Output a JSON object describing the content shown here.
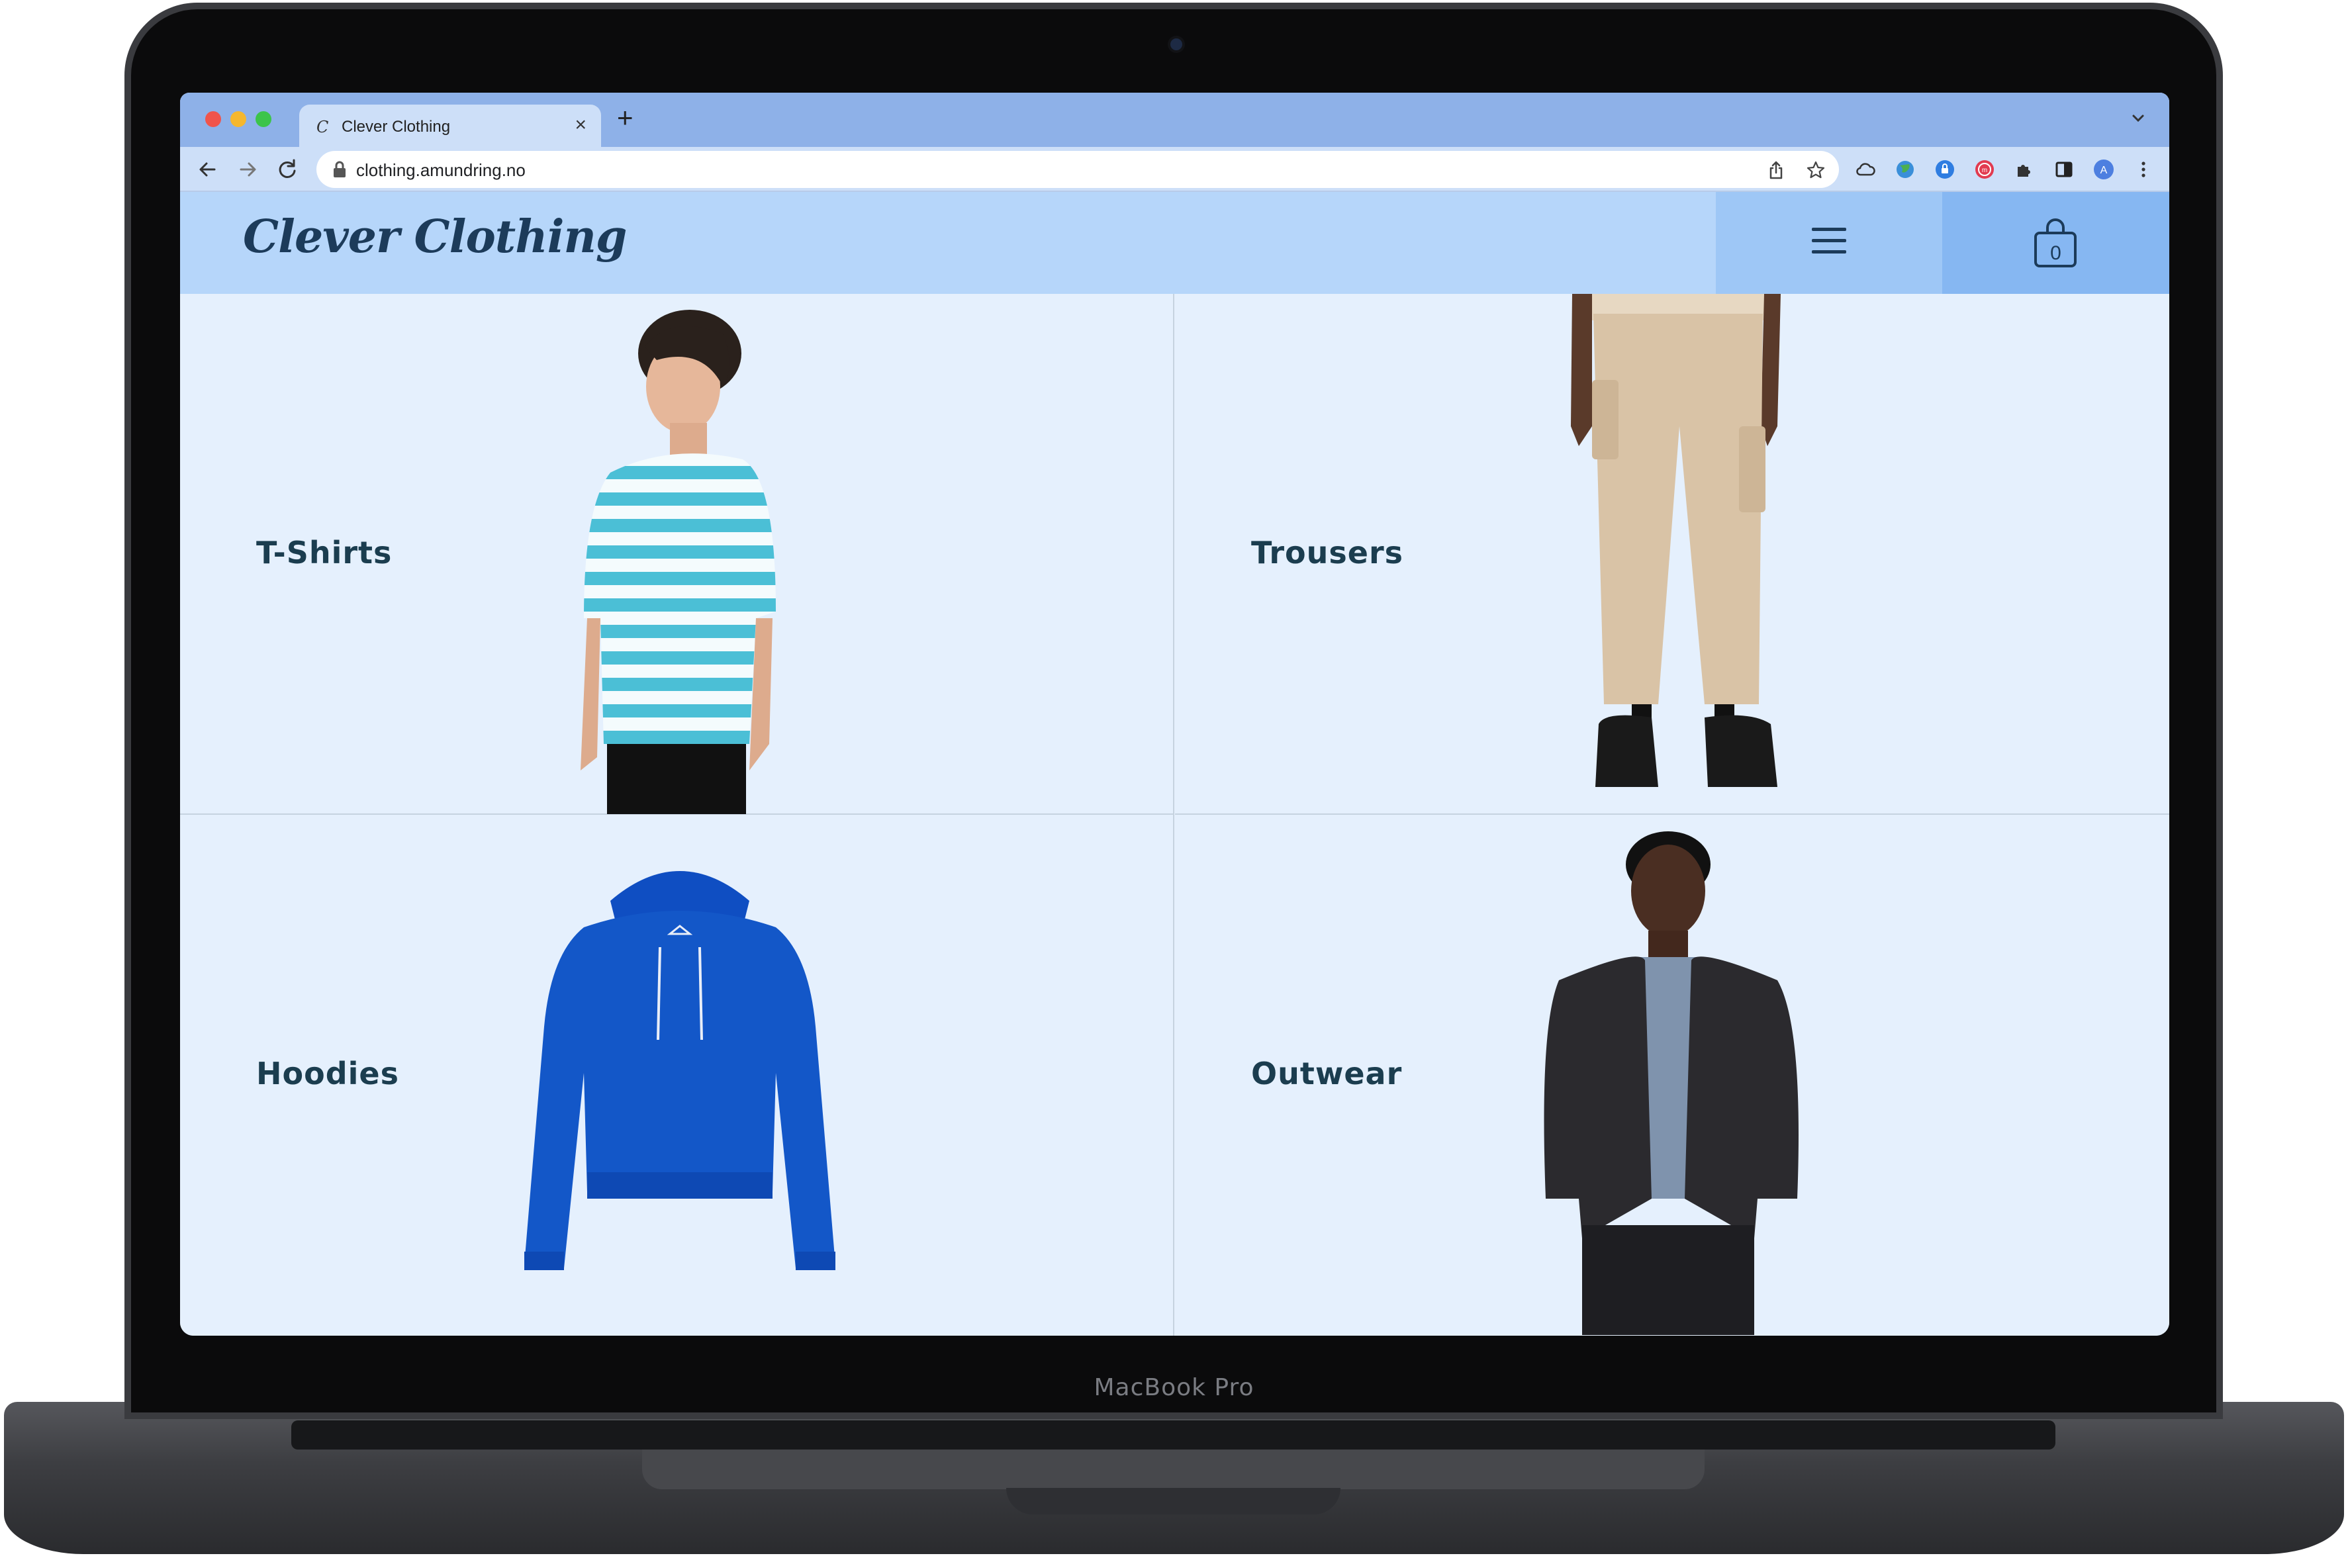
{
  "device": {
    "label": "MacBook Pro"
  },
  "browser": {
    "tab": {
      "favicon": "C",
      "title": "Clever Clothing",
      "close": "×"
    },
    "new_tab": "+",
    "url": "clothing.amundring.no"
  },
  "site": {
    "logo": "Clever Clothing",
    "cart_count": "0"
  },
  "categories": [
    {
      "label": "T-Shirts",
      "icon": "striped-tshirt-model"
    },
    {
      "label": "Trousers",
      "icon": "beige-trousers-model"
    },
    {
      "label": "Hoodies",
      "icon": "blue-hoodie"
    },
    {
      "label": "Outwear",
      "icon": "corduroy-jacket-model"
    }
  ],
  "colors": {
    "tabbar": "#8eb1e8",
    "toolbar": "#cddff8",
    "header": "#b6d6fa",
    "menu_button": "#9ec7f6",
    "cart_button": "#86b7f2",
    "content": "#e5f0fd",
    "label_text": "#1b3d4f"
  }
}
